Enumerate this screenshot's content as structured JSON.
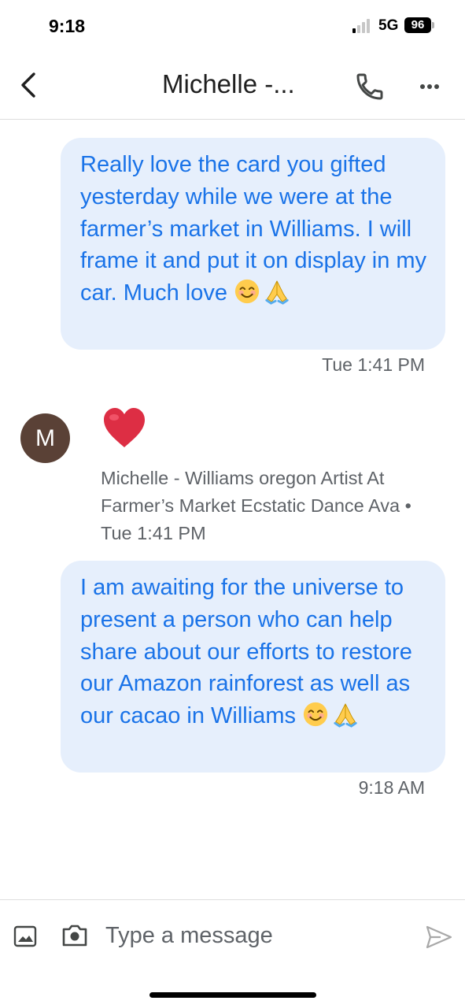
{
  "status_bar": {
    "time": "9:18",
    "network": "5G",
    "battery": "96"
  },
  "header": {
    "title": "Michelle -...",
    "icons": {
      "back": "chevron-left",
      "call": "phone",
      "more": "more-horizontal"
    }
  },
  "messages": [
    {
      "direction": "outgoing",
      "text": "Really love the card you gifted yesterday while we were at the farmer’s market in Williams. I will frame it and put it on display in my car. Much love",
      "emojis": [
        "smiling-face",
        "folded-hands"
      ],
      "timestamp": "Tue 1:41 PM"
    },
    {
      "direction": "incoming",
      "avatar_letter": "M",
      "reaction": "red-heart",
      "sender": "Michelle - Williams oregon Artist At Farmer’s Market Ecstatic Dance Ava",
      "timestamp": "Tue 1:41 PM"
    },
    {
      "direction": "outgoing",
      "text": "I am awaiting for the universe to present a person who can help share about our efforts to restore our Amazon rainforest as well as our cacao in Williams",
      "emojis": [
        "smiling-face",
        "folded-hands"
      ],
      "timestamp": "9:18 AM"
    }
  ],
  "composer": {
    "placeholder": "Type a message",
    "value": "",
    "icons": {
      "gallery": "image",
      "camera": "camera",
      "send": "send"
    }
  },
  "colors": {
    "outgoing_bubble_bg": "#e6effc",
    "outgoing_text": "#1a73e8",
    "meta_text": "#5f6368",
    "avatar_bg": "#5a4136"
  }
}
